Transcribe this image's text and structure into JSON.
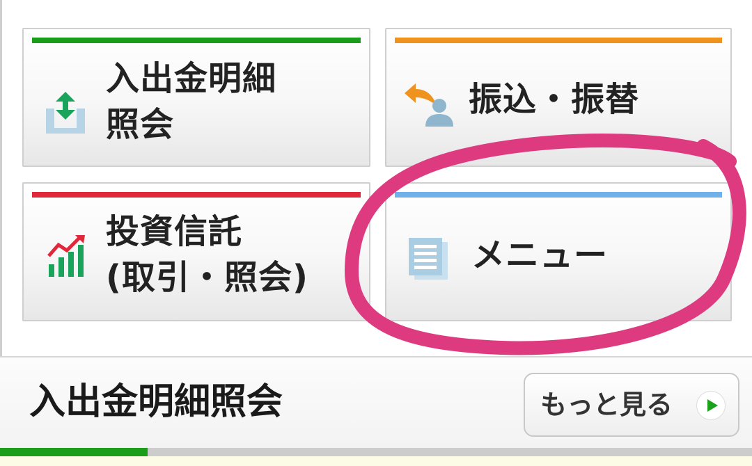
{
  "tiles": [
    {
      "label_lines": [
        "入出金明細",
        "照会"
      ],
      "icon": "deposit-withdrawal-icon",
      "bar_color": "#1a9e1a"
    },
    {
      "label": "振込・振替",
      "icon": "transfer-person-icon",
      "bar_color": "#f0921e"
    },
    {
      "label_lines": [
        "投資信託",
        "(取引・照会)"
      ],
      "icon": "investment-chart-icon",
      "bar_color": "#e0283a"
    },
    {
      "label": "メニュー",
      "icon": "menu-document-icon",
      "bar_color": "#6fb1e8"
    }
  ],
  "annotation": {
    "shape": "hand-drawn-circle",
    "color": "#de3a80",
    "target": "menu"
  },
  "section": {
    "title": "入出金明細照会",
    "more_label": "もっと見る",
    "more_icon": "play-arrow-icon",
    "arrow_color": "#1aa01a",
    "active_tab_color": "#1a9e1a"
  }
}
